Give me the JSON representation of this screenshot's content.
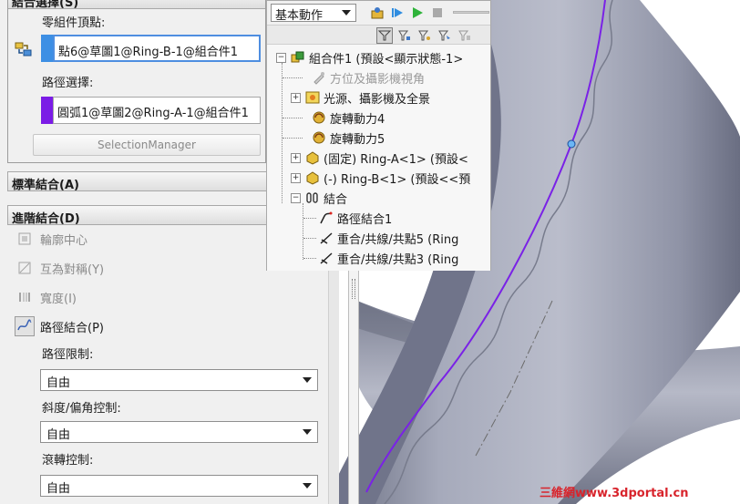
{
  "left_panel": {
    "selection_section": {
      "header": "結合選擇(S)",
      "component_vertex_label": "零組件頂點:",
      "component_vertex_value": "點6@草圖1@Ring-B-1@組合件1",
      "path_selection_label": "路徑選擇:",
      "path_selection_value": "圓弧1@草圖2@Ring-A-1@組合件1",
      "selection_manager_label": "SelectionManager"
    },
    "standard_mates_header": "標準結合(A)",
    "advanced_mates": {
      "header": "進階結合(D)",
      "items": [
        {
          "label": "輪廓中心",
          "icon": "profile-center-icon",
          "active": false
        },
        {
          "label": "互為對稱(Y)",
          "icon": "symmetric-icon",
          "active": false
        },
        {
          "label": "寬度(I)",
          "icon": "width-icon",
          "active": false
        },
        {
          "label": "路徑結合(P)",
          "icon": "path-mate-icon",
          "active": true
        }
      ],
      "path_constraint_label": "路徑限制:",
      "path_constraint_value": "自由",
      "pitch_yaw_label": "斜度/偏角控制:",
      "pitch_yaw_value": "自由",
      "roll_control_label": "滾轉控制:",
      "roll_control_value": "自由"
    }
  },
  "tree": {
    "motion_study_value": "基本動作",
    "root": "組合件1 (預設<顯示狀態-1>",
    "items": [
      {
        "label": "方位及攝影機視角",
        "icon": "camera-icon",
        "dim": true,
        "expand": ""
      },
      {
        "label": "光源、攝影機及全景",
        "icon": "lights-icon",
        "dim": false,
        "expand": "+"
      },
      {
        "label": "旋轉動力4",
        "icon": "rotary-motor-icon",
        "dim": false,
        "expand": ""
      },
      {
        "label": "旋轉動力5",
        "icon": "rotary-motor-icon",
        "dim": false,
        "expand": ""
      },
      {
        "label": "(固定) Ring-A<1> (預設<",
        "icon": "part-icon",
        "dim": false,
        "expand": "+"
      },
      {
        "label": "(-) Ring-B<1> (預設<<預",
        "icon": "part-icon",
        "dim": false,
        "expand": "+"
      },
      {
        "label": "結合",
        "icon": "mates-folder-icon",
        "dim": false,
        "expand": "−"
      }
    ],
    "mates": [
      {
        "label": "路徑結合1",
        "icon": "path-mate-icon"
      },
      {
        "label": "重合/共線/共點5 (Ring",
        "icon": "coincident-icon"
      },
      {
        "label": "重合/共線/共點3 (Ring",
        "icon": "coincident-icon"
      }
    ]
  },
  "watermark": "三維網www.3dportal.cn",
  "colors": {
    "path_curve": "#7a22e6",
    "ring_body": "#9ea2b4",
    "blue_swatch": "#3d8fe4",
    "purple_swatch": "#7b1ce6",
    "watermark": "#d8242c"
  }
}
